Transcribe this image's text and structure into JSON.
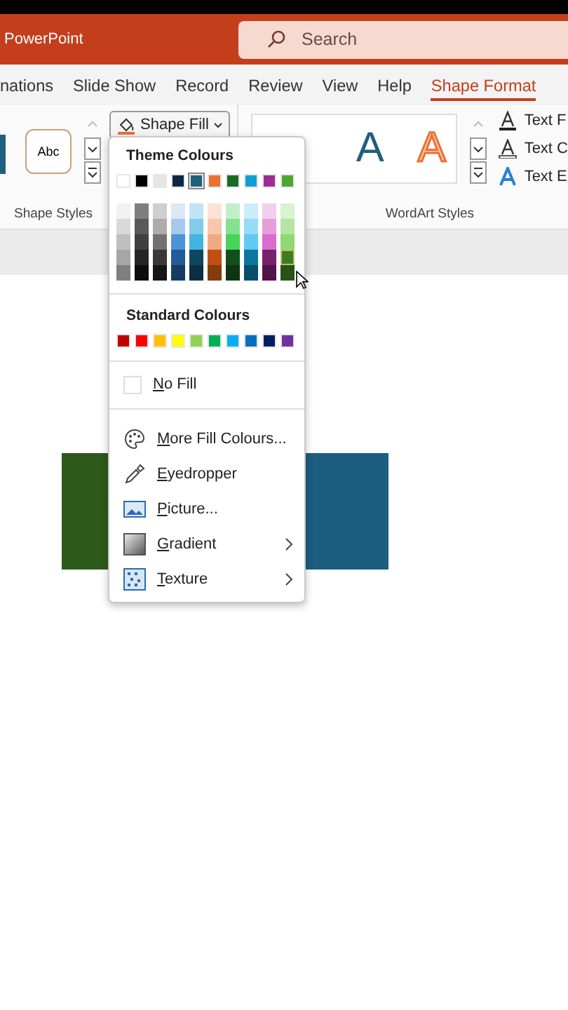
{
  "title_bar": {
    "app_name": "PowerPoint",
    "search": {
      "placeholder": "Search"
    }
  },
  "tabs": [
    {
      "label": "nations",
      "selected": false
    },
    {
      "label": "Slide Show",
      "selected": false
    },
    {
      "label": "Record",
      "selected": false
    },
    {
      "label": "Review",
      "selected": false
    },
    {
      "label": "View",
      "selected": false
    },
    {
      "label": "Help",
      "selected": false
    },
    {
      "label": "Shape Format",
      "selected": true
    }
  ],
  "ribbon": {
    "shape_styles": {
      "sample": "Abc",
      "label": "Shape Styles",
      "shape_fill_button": "Shape Fill"
    },
    "wordart_styles": {
      "samples": [
        {
          "text": "A",
          "kind": "outline"
        },
        {
          "text": "A",
          "kind": "glow"
        }
      ],
      "label": "WordArt Styles"
    },
    "text_buttons": [
      {
        "label": "Text F",
        "kind": "fill"
      },
      {
        "label": "Text C",
        "kind": "outline"
      },
      {
        "label": "Text E",
        "kind": "effects"
      }
    ]
  },
  "shape_fill_menu": {
    "theme_heading": "Theme Colours",
    "theme_colours": [
      {
        "color": "#ffffff",
        "selected": false,
        "shades": [
          {
            "color": "#f2f2f2",
            "selected": false
          },
          {
            "color": "#d9d9d9",
            "selected": false
          },
          {
            "color": "#bfbfbf",
            "selected": false
          },
          {
            "color": "#a6a6a6",
            "selected": false
          },
          {
            "color": "#7f7f7f",
            "selected": false
          }
        ]
      },
      {
        "color": "#000000",
        "selected": false,
        "shades": [
          {
            "color": "#7f7f7f",
            "selected": false
          },
          {
            "color": "#595959",
            "selected": false
          },
          {
            "color": "#404040",
            "selected": false
          },
          {
            "color": "#262626",
            "selected": false
          },
          {
            "color": "#0d0d0d",
            "selected": false
          }
        ]
      },
      {
        "color": "#e7e6e6",
        "selected": false,
        "shades": [
          {
            "color": "#d0cece",
            "selected": false
          },
          {
            "color": "#afabab",
            "selected": false
          },
          {
            "color": "#767171",
            "selected": false
          },
          {
            "color": "#3a3838",
            "selected": false
          },
          {
            "color": "#171616",
            "selected": false
          }
        ]
      },
      {
        "color": "#0e2841",
        "selected": false,
        "shades": [
          {
            "color": "#dae9f8",
            "selected": false
          },
          {
            "color": "#a6c9ec",
            "selected": false
          },
          {
            "color": "#4d93d9",
            "selected": false
          },
          {
            "color": "#215c98",
            "selected": false
          },
          {
            "color": "#153d64",
            "selected": false
          }
        ]
      },
      {
        "color": "#1f5f7f",
        "selected": true,
        "shades": [
          {
            "color": "#c0e4f5",
            "selected": false
          },
          {
            "color": "#83cbeb",
            "selected": false
          },
          {
            "color": "#44b3e1",
            "selected": false
          },
          {
            "color": "#0f4761",
            "selected": false
          },
          {
            "color": "#0a2f40",
            "selected": false
          }
        ]
      },
      {
        "color": "#e97132",
        "selected": false,
        "shades": [
          {
            "color": "#fbe2d5",
            "selected": false
          },
          {
            "color": "#f7c7ac",
            "selected": false
          },
          {
            "color": "#f1a983",
            "selected": false
          },
          {
            "color": "#c04f15",
            "selected": false
          },
          {
            "color": "#843c0c",
            "selected": false
          }
        ]
      },
      {
        "color": "#196b24",
        "selected": false,
        "shades": [
          {
            "color": "#c1f0c8",
            "selected": false
          },
          {
            "color": "#83e28e",
            "selected": false
          },
          {
            "color": "#47d459",
            "selected": false
          },
          {
            "color": "#124f1a",
            "selected": false
          },
          {
            "color": "#0d3512",
            "selected": false
          }
        ]
      },
      {
        "color": "#0f9ed5",
        "selected": false,
        "shades": [
          {
            "color": "#caedfb",
            "selected": false
          },
          {
            "color": "#94dcf8",
            "selected": false
          },
          {
            "color": "#60caf3",
            "selected": false
          },
          {
            "color": "#0b769f",
            "selected": false
          },
          {
            "color": "#074f6a",
            "selected": false
          }
        ]
      },
      {
        "color": "#a02b93",
        "selected": false,
        "shades": [
          {
            "color": "#f2cfee",
            "selected": false
          },
          {
            "color": "#e59edd",
            "selected": false
          },
          {
            "color": "#d86dcd",
            "selected": false
          },
          {
            "color": "#77206d",
            "selected": false
          },
          {
            "color": "#501549",
            "selected": false
          }
        ]
      },
      {
        "color": "#4ea72e",
        "selected": false,
        "shades": [
          {
            "color": "#d9f2d0",
            "selected": false
          },
          {
            "color": "#b4e5a2",
            "selected": false
          },
          {
            "color": "#8ed973",
            "selected": false
          },
          {
            "color": "#3b7d23",
            "selected": true
          },
          {
            "color": "#275317",
            "selected": false
          }
        ]
      }
    ],
    "standard_heading": "Standard Colours",
    "standard_colours": [
      {
        "color": "#c00000"
      },
      {
        "color": "#ff0000"
      },
      {
        "color": "#ffc000"
      },
      {
        "color": "#ffff00"
      },
      {
        "color": "#92d050"
      },
      {
        "color": "#00b050"
      },
      {
        "color": "#00b0f0"
      },
      {
        "color": "#0070c0"
      },
      {
        "color": "#002060"
      },
      {
        "color": "#7030a0"
      }
    ],
    "no_fill": "No Fill",
    "items": [
      {
        "label": "More Fill Colours...",
        "kind": "palette",
        "submenu": false
      },
      {
        "label": "Eyedropper",
        "kind": "eyedropper",
        "submenu": false
      },
      {
        "label": "Picture...",
        "kind": "picture",
        "submenu": false
      },
      {
        "label": "Gradient",
        "kind": "gradient",
        "submenu": true
      },
      {
        "label": "Texture",
        "kind": "texture",
        "submenu": true
      }
    ]
  }
}
